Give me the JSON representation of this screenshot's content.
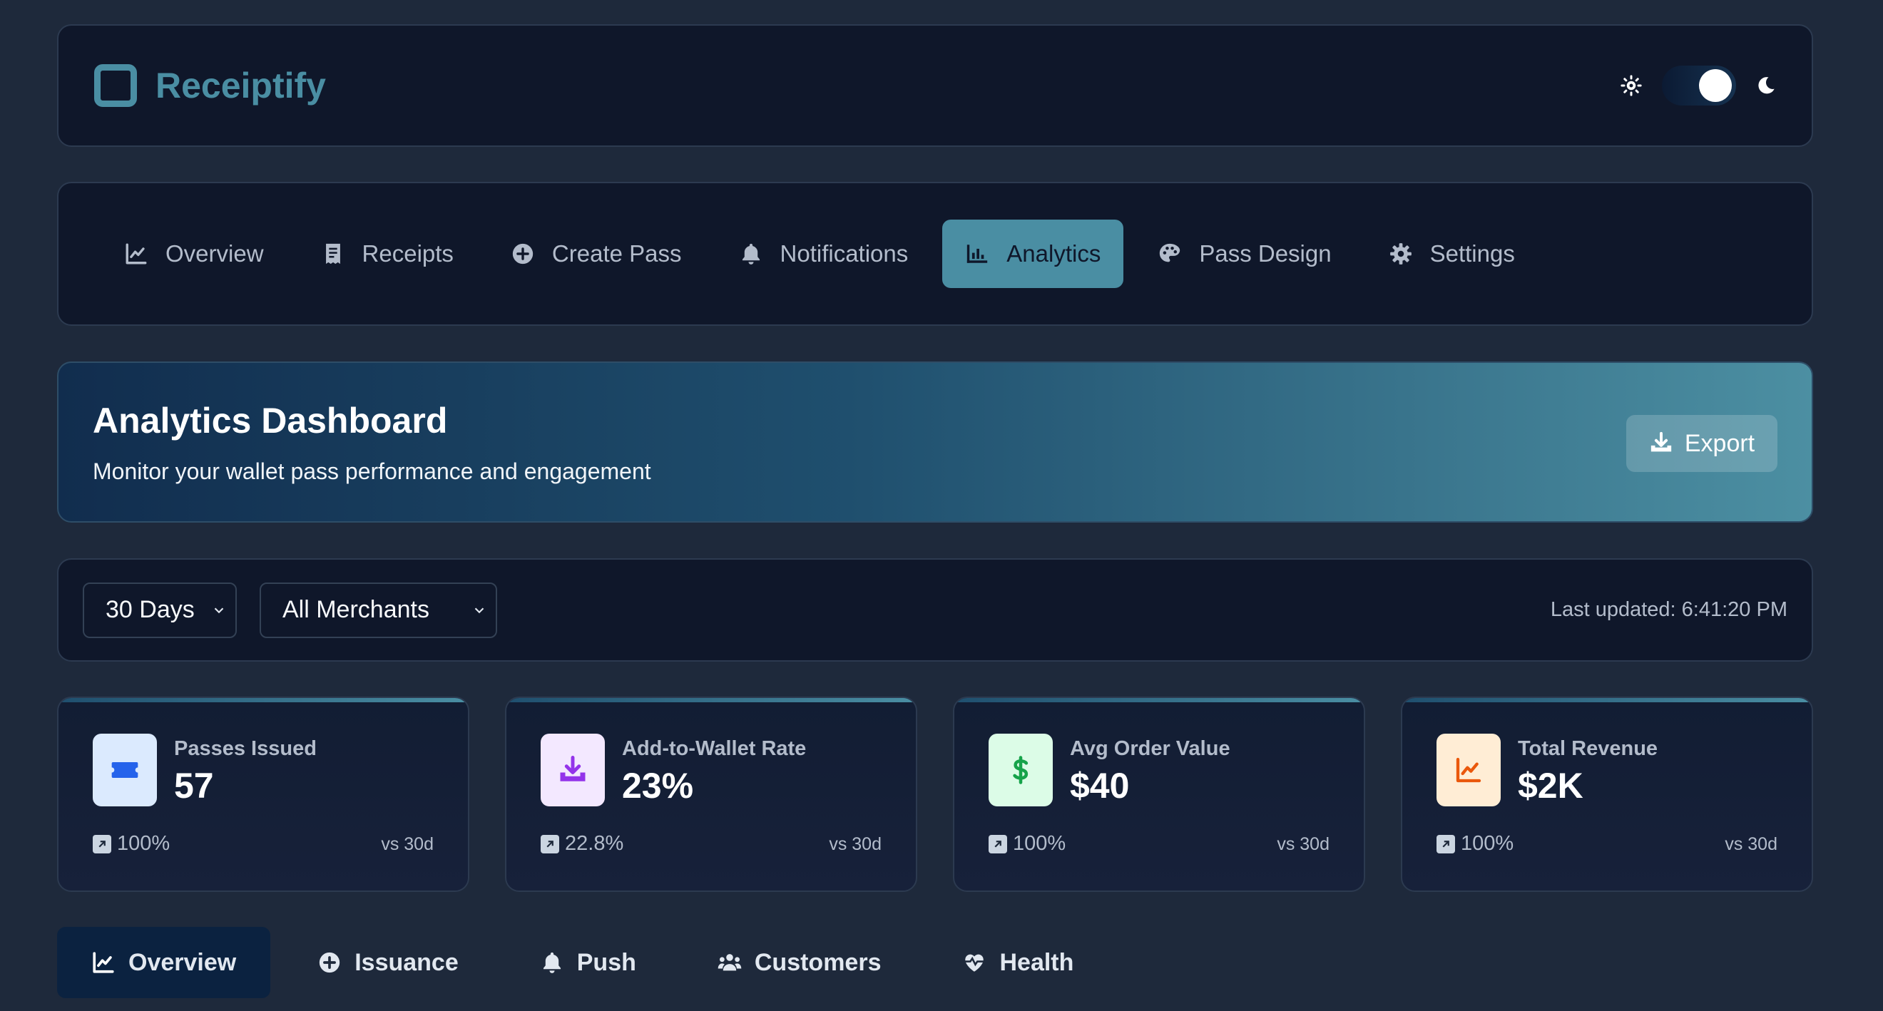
{
  "app": {
    "name": "Receiptify"
  },
  "nav": {
    "items": [
      {
        "label": "Overview",
        "icon": "line-chart-icon",
        "active": false
      },
      {
        "label": "Receipts",
        "icon": "receipt-icon",
        "active": false
      },
      {
        "label": "Create Pass",
        "icon": "plus-circle-icon",
        "active": false
      },
      {
        "label": "Notifications",
        "icon": "bell-icon",
        "active": false
      },
      {
        "label": "Analytics",
        "icon": "bar-chart-icon",
        "active": true
      },
      {
        "label": "Pass Design",
        "icon": "palette-icon",
        "active": false
      },
      {
        "label": "Settings",
        "icon": "gear-icon",
        "active": false
      }
    ]
  },
  "hero": {
    "title": "Analytics Dashboard",
    "subtitle": "Monitor your wallet pass performance and engagement",
    "export_label": "Export"
  },
  "filters": {
    "range": "30 Days",
    "merchant": "All Merchants",
    "last_updated": "Last updated: 6:41:20 PM"
  },
  "stats": [
    {
      "label": "Passes Issued",
      "value": "57",
      "change": "100%",
      "compare": "vs 30d",
      "icon": "ticket-icon",
      "icon_bg": "#dbeafe",
      "icon_color": "#2563eb"
    },
    {
      "label": "Add-to-Wallet Rate",
      "value": "23%",
      "change": "22.8%",
      "compare": "vs 30d",
      "icon": "download-icon",
      "icon_bg": "#f3e8ff",
      "icon_color": "#9333ea"
    },
    {
      "label": "Avg Order Value",
      "value": "$40",
      "change": "100%",
      "compare": "vs 30d",
      "icon": "dollar-icon",
      "icon_bg": "#dcfce7",
      "icon_color": "#16a34a"
    },
    {
      "label": "Total Revenue",
      "value": "$2K",
      "change": "100%",
      "compare": "vs 30d",
      "icon": "trend-icon",
      "icon_bg": "#ffedd5",
      "icon_color": "#ea580c"
    }
  ],
  "tabs": [
    {
      "label": "Overview",
      "icon": "line-chart-icon",
      "active": true
    },
    {
      "label": "Issuance",
      "icon": "plus-circle-icon",
      "active": false
    },
    {
      "label": "Push",
      "icon": "bell-icon",
      "active": false
    },
    {
      "label": "Customers",
      "icon": "users-icon",
      "active": false
    },
    {
      "label": "Health",
      "icon": "heart-pulse-icon",
      "active": false
    }
  ],
  "colors": {
    "accent": "#4a8ea3",
    "background": "#1e293b",
    "card": "#0f172a"
  }
}
